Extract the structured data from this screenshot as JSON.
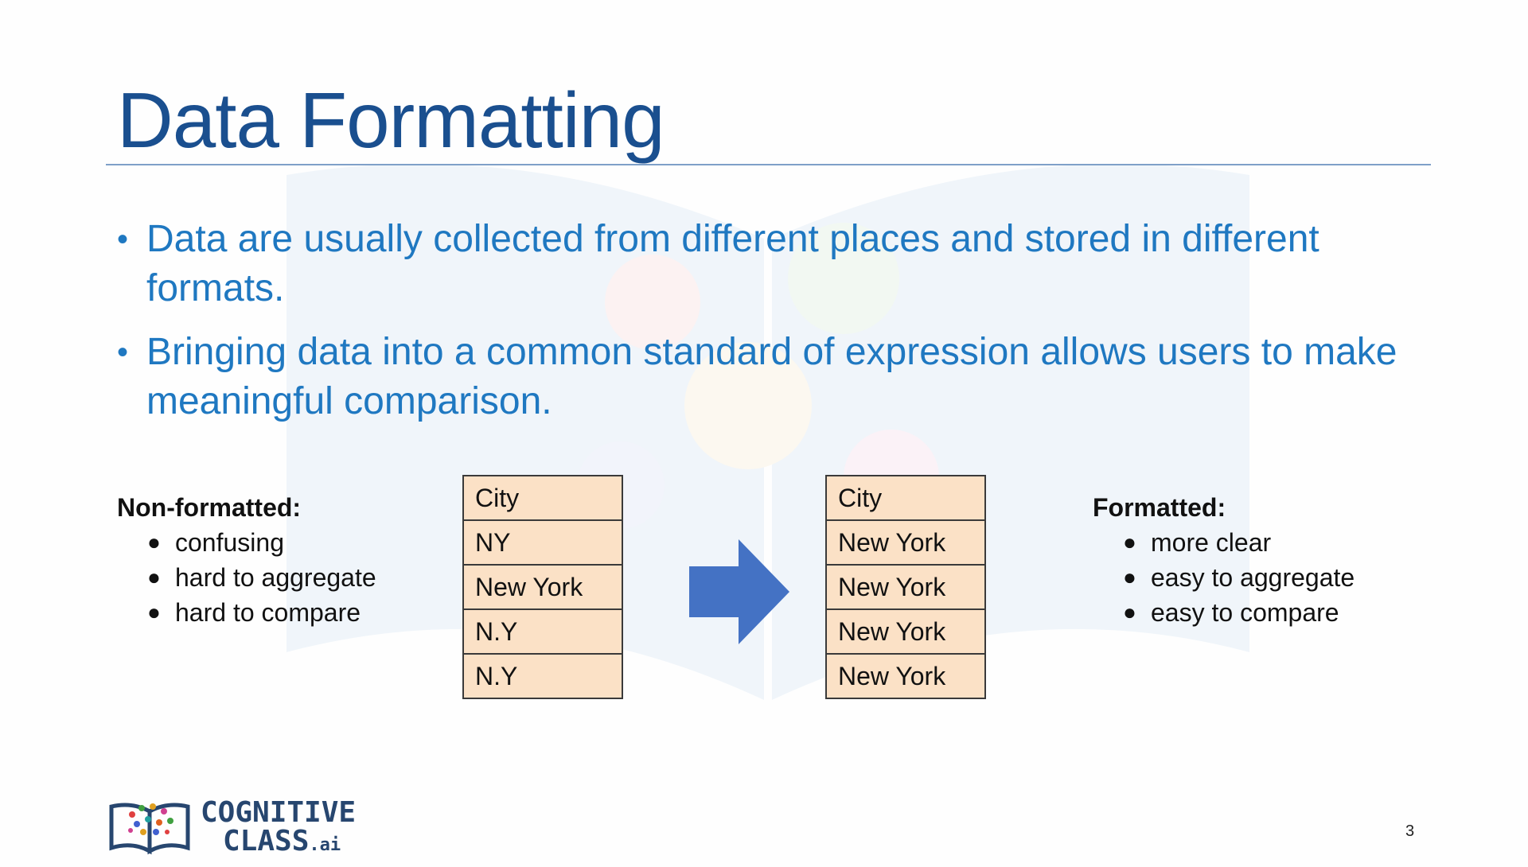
{
  "slide": {
    "title": "Data Formatting",
    "bullets": [
      "Data are usually collected from different places and stored in different formats.",
      "Bringing data into a common standard of expression allows users to make meaningful comparison."
    ],
    "non_formatted": {
      "heading": "Non-formatted:",
      "items": [
        "confusing",
        "hard to aggregate",
        "hard to compare"
      ]
    },
    "formatted": {
      "heading": "Formatted:",
      "items": [
        "more clear",
        "easy to aggregate",
        "easy to compare"
      ]
    },
    "table_before": {
      "header": "City",
      "rows": [
        "NY",
        "New York",
        "N.Y",
        "N.Y"
      ]
    },
    "table_after": {
      "header": "City",
      "rows": [
        "New York",
        "New York",
        "New York",
        "New York"
      ]
    },
    "arrow_icon": "right-arrow-icon",
    "logo": {
      "line1": "COGNITIVE",
      "line2": "CLASS",
      "suffix": ".ai"
    },
    "page_number": "3",
    "colors": {
      "title": "#1a4f8f",
      "bullet_text": "#1f78c1",
      "table_fill": "#fbe1c6",
      "arrow": "#4472c4"
    }
  }
}
